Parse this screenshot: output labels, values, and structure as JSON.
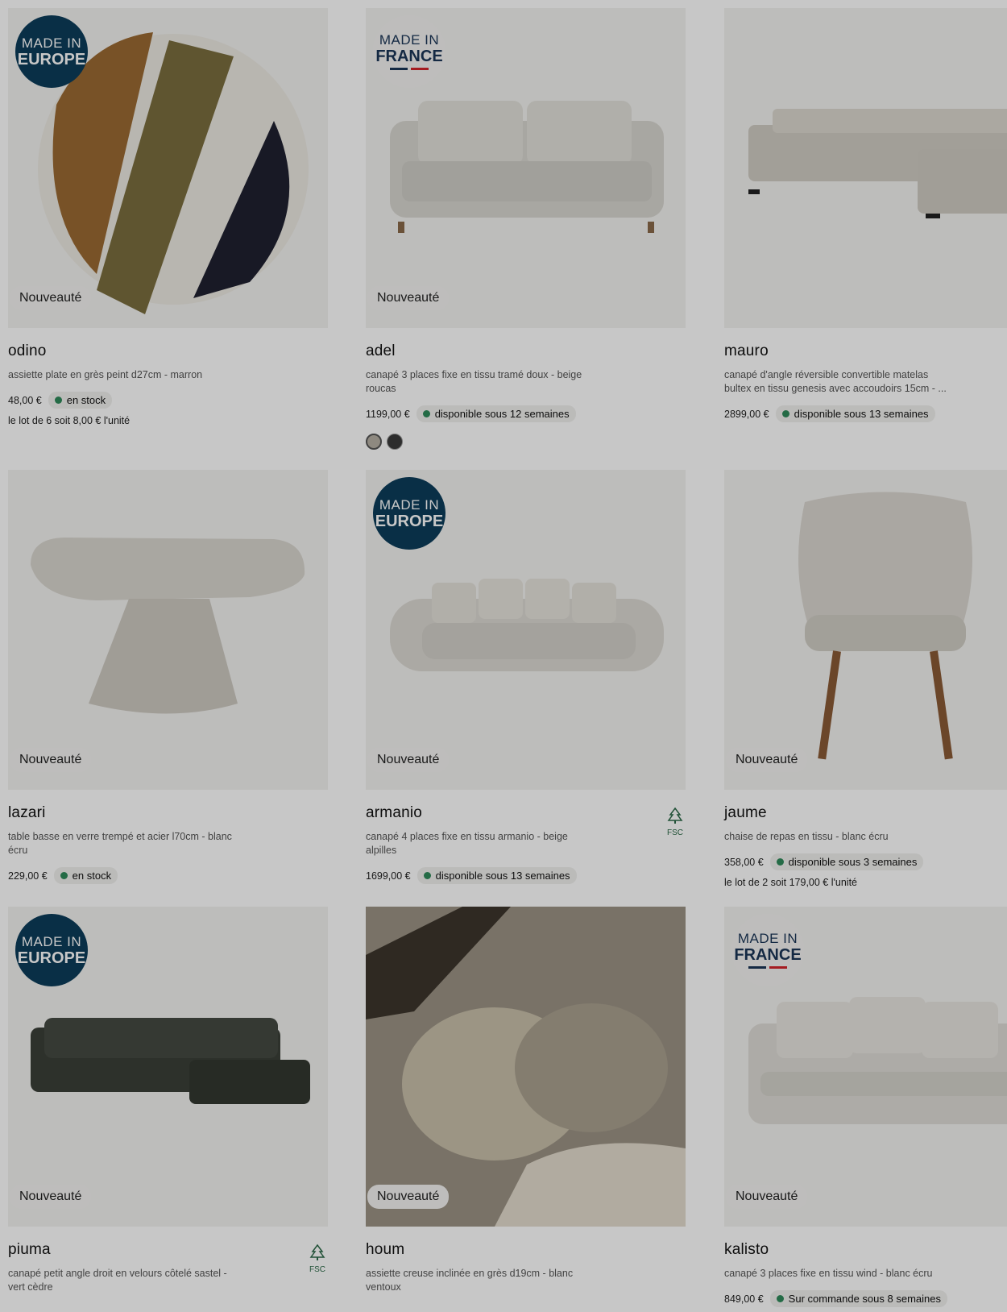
{
  "products": [
    {
      "badge": "Nouveauté",
      "made": "EUROPE",
      "title": "odino",
      "desc": "assiette plate en grès peint d27cm - marron",
      "price": "48,00 €",
      "status": "en stock",
      "lot": "le lot de 6 soit 8,00 € l'unité"
    },
    {
      "badge": "Nouveauté",
      "made": "FRANCE",
      "title": "adel",
      "desc": "canapé 3 places fixe en tissu tramé doux - beige roucas",
      "price": "1199,00 €",
      "status": "disponible sous 12 semaines",
      "swatches": [
        "#b6b0a4",
        "#3a3a3a"
      ]
    },
    {
      "badge": "",
      "made": "",
      "title": "mauro",
      "desc": "canapé d'angle réversible convertible matelas bultex en tissu genesis avec accoudoirs 15cm - ...",
      "price": "2899,00 €",
      "status": "disponible sous 13 semaines"
    },
    {
      "badge": "Nouveauté",
      "made": "",
      "title": "lazari",
      "desc": "table basse en verre trempé et acier l70cm - blanc écru",
      "price": "229,00 €",
      "status": "en stock"
    },
    {
      "badge": "Nouveauté",
      "made": "EUROPE",
      "title": "armanio",
      "desc": "canapé 4 places fixe en tissu armanio - beige alpilles",
      "price": "1699,00 €",
      "status": "disponible sous 13 semaines",
      "fsc": "FSC"
    },
    {
      "badge": "Nouveauté",
      "made": "",
      "title": "jaume",
      "desc": "chaise de repas en tissu - blanc écru",
      "price": "358,00 €",
      "status": "disponible sous 3 semaines",
      "lot": "le lot de 2 soit 179,00 € l'unité"
    },
    {
      "badge": "Nouveauté",
      "made": "EUROPE",
      "title": "piuma",
      "desc": "canapé petit angle droit en velours côtelé sastel - vert cèdre",
      "price": "",
      "status": "",
      "fsc": "FSC"
    },
    {
      "badge": "Nouveauté",
      "made": "",
      "title": "houm",
      "desc": "assiette creuse inclinée en grès d19cm - blanc ventoux",
      "price": "",
      "status": ""
    },
    {
      "badge": "Nouveauté",
      "made": "FRANCE",
      "title": "kalisto",
      "desc": "canapé 3 places fixe en tissu wind - blanc écru",
      "price": "849,00 €",
      "status": "Sur commande sous 8 semaines"
    }
  ],
  "made_in": {
    "line1": "MADE IN",
    "europe": "EUROPE",
    "france": "FRANCE"
  },
  "colors": {
    "status_dot": "#2f8a5a",
    "made_eu_bg": "#0c3d5a"
  },
  "icons": [
    "fsc-tree-icon"
  ]
}
